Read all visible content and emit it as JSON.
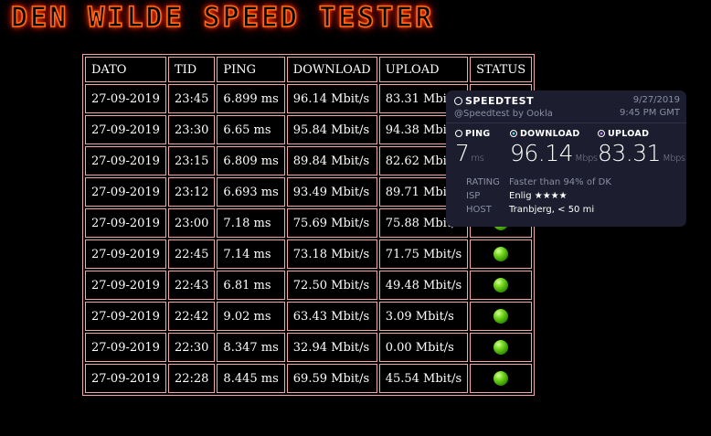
{
  "page": {
    "title": "DEN WILDE SPEED TESTER"
  },
  "table": {
    "headers": [
      "DATO",
      "TID",
      "PING",
      "DOWNLOAD",
      "UPLOAD",
      "STATUS"
    ],
    "rows": [
      {
        "dato": "27-09-2019",
        "tid": "23:45",
        "ping": "6.899 ms",
        "download": "96.14 Mbit/s",
        "upload": "83.31 Mbit/s",
        "status": "green"
      },
      {
        "dato": "27-09-2019",
        "tid": "23:30",
        "ping": "6.65 ms",
        "download": "95.84 Mbit/s",
        "upload": "94.38 Mbit/s",
        "status": "green"
      },
      {
        "dato": "27-09-2019",
        "tid": "23:15",
        "ping": "6.809 ms",
        "download": "89.84 Mbit/s",
        "upload": "82.62 Mbit/s",
        "status": "green"
      },
      {
        "dato": "27-09-2019",
        "tid": "23:12",
        "ping": "6.693 ms",
        "download": "93.49 Mbit/s",
        "upload": "89.71 Mbit/s",
        "status": "green"
      },
      {
        "dato": "27-09-2019",
        "tid": "23:00",
        "ping": "7.18 ms",
        "download": "75.69 Mbit/s",
        "upload": "75.88 Mbit/s",
        "status": "green"
      },
      {
        "dato": "27-09-2019",
        "tid": "22:45",
        "ping": "7.14 ms",
        "download": "73.18 Mbit/s",
        "upload": "71.75 Mbit/s",
        "status": "green"
      },
      {
        "dato": "27-09-2019",
        "tid": "22:43",
        "ping": "6.81 ms",
        "download": "72.50 Mbit/s",
        "upload": "49.48 Mbit/s",
        "status": "green"
      },
      {
        "dato": "27-09-2019",
        "tid": "22:42",
        "ping": "9.02 ms",
        "download": "63.43 Mbit/s",
        "upload": "3.09 Mbit/s",
        "status": "green"
      },
      {
        "dato": "27-09-2019",
        "tid": "22:30",
        "ping": "8.347 ms",
        "download": "32.94 Mbit/s",
        "upload": "0.00 Mbit/s",
        "status": "green"
      },
      {
        "dato": "27-09-2019",
        "tid": "22:28",
        "ping": "8.445 ms",
        "download": "69.59 Mbit/s",
        "upload": "45.54 Mbit/s",
        "status": "green"
      }
    ]
  },
  "card": {
    "brand": "SPEEDTEST",
    "handle": "@Speedtest by Ookla",
    "date": "9/27/2019",
    "time": "9:45 PM GMT",
    "ping_label": "PING",
    "ping_value": "7",
    "ping_unit": "ms",
    "download_label": "DOWNLOAD",
    "download_value": "96.14",
    "download_unit": "Mbps",
    "upload_label": "UPLOAD",
    "upload_value": "83.31",
    "upload_unit": "Mbps",
    "rating_label": "RATING",
    "rating_value": "Faster than 94% of DK",
    "isp_label": "ISP",
    "isp_value": "Enlig",
    "isp_stars": "★★★★",
    "host_label": "HOST",
    "host_value": "Tranbjerg, < 50 mi"
  },
  "colors": {
    "title_glow": "#ff3c00",
    "table_border": "#f2a6a6",
    "status_ok": "#5cc814",
    "download_accent": "#4fd1e0",
    "upload_accent": "#c37cf2",
    "card_bg": "#1c1d2e"
  }
}
